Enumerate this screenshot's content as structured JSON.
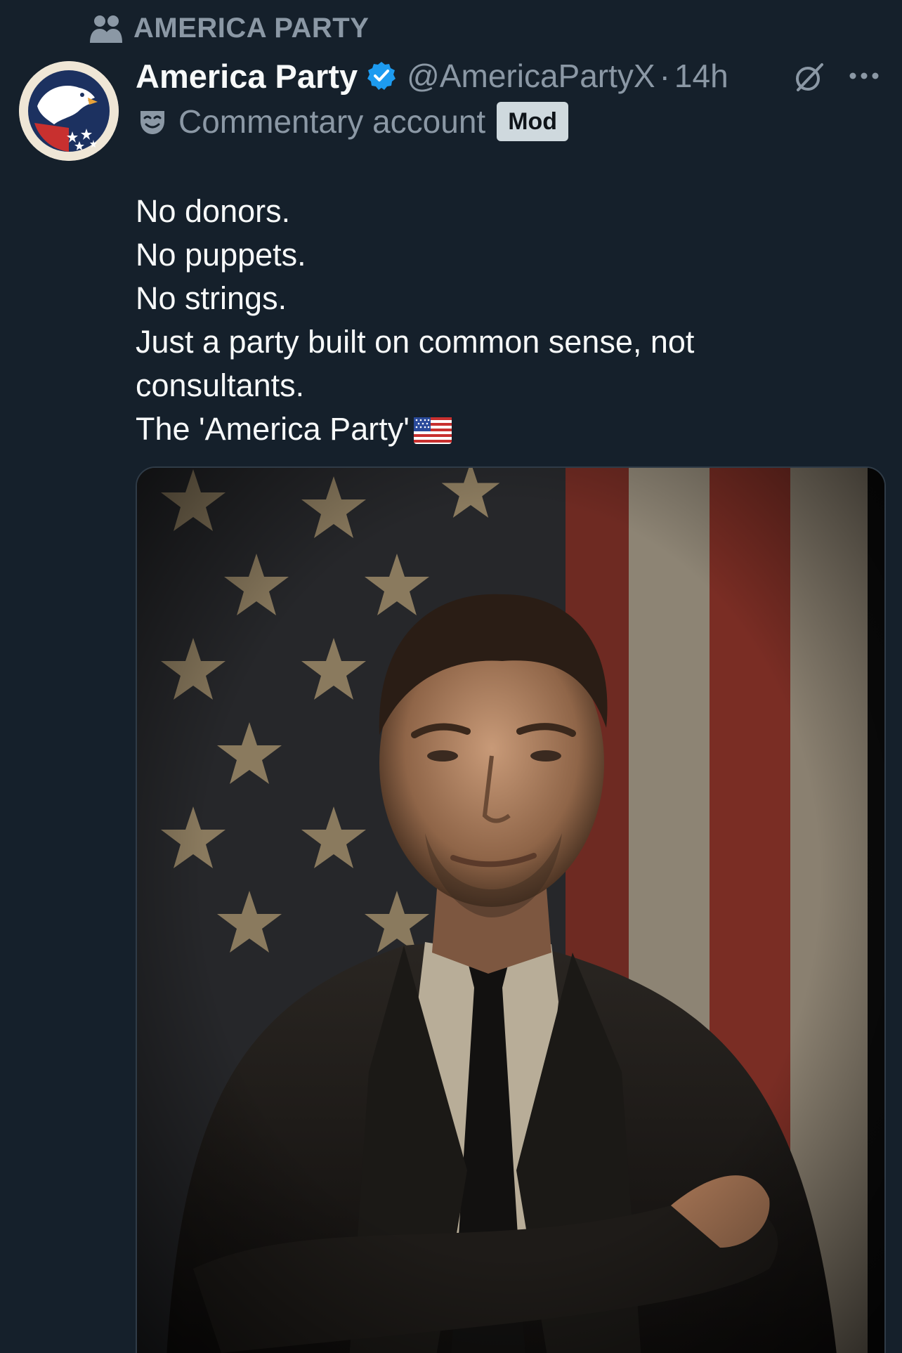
{
  "community": {
    "name": "AMERICA PARTY",
    "icon": "people-icon"
  },
  "author": {
    "display_name": "America Party",
    "verified": true,
    "handle": "@AmericaPartyX",
    "separator": "·",
    "timestamp": "14h",
    "account_label": "Commentary account",
    "badge": "Mod"
  },
  "tweet": {
    "lines": [
      "No donors.",
      "No puppets.",
      "No strings.",
      "Just a party built on common sense, not",
      "consultants.",
      "The 'America Party'"
    ],
    "emoji": "us-flag-emoji"
  },
  "icons": {
    "grok": "grok-icon",
    "more": "more-icon",
    "verified": "verified-badge-icon",
    "mask": "commentary-mask-icon"
  },
  "colors": {
    "background": "#15202b",
    "text": "#f7f9f9",
    "secondary": "#8b98a5",
    "verified": "#1d9bf0",
    "badge_bg": "#cfd9de"
  }
}
